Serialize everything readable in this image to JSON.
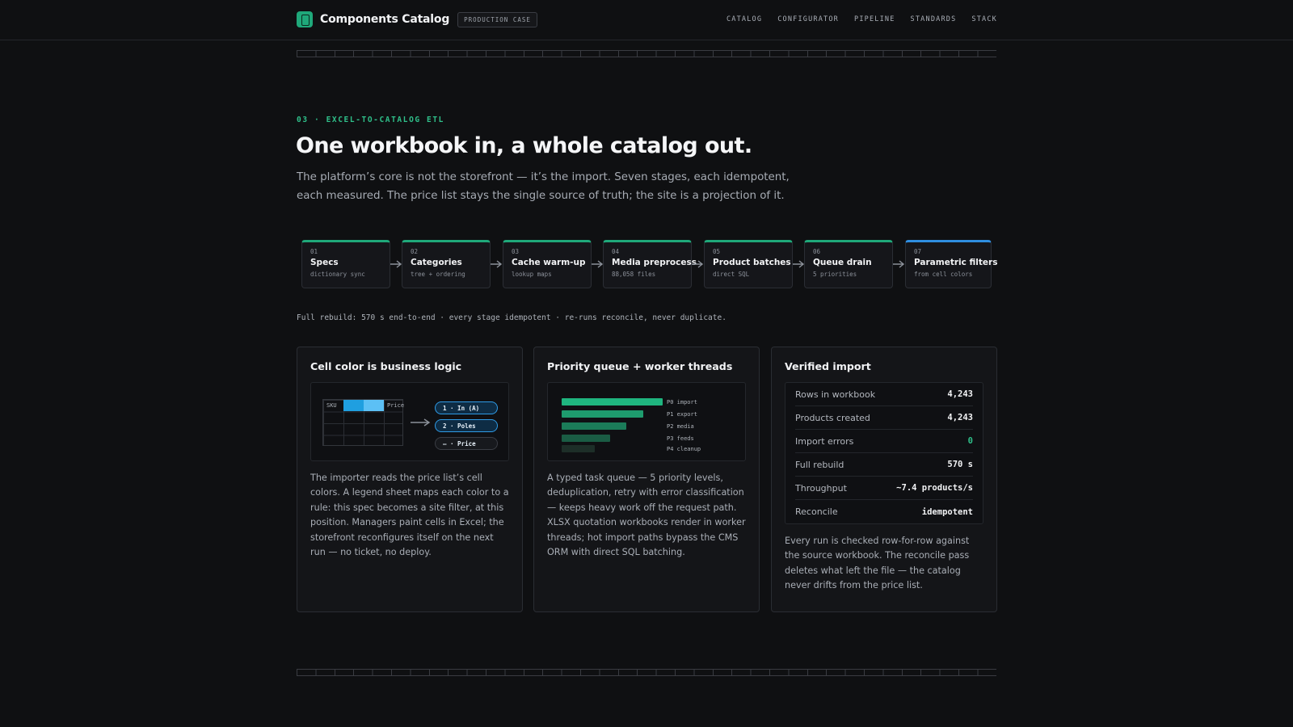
{
  "header": {
    "brand": "Components Catalog",
    "badge": "PRODUCTION CASE",
    "nav": [
      "CATALOG",
      "CONFIGURATOR",
      "PIPELINE",
      "STANDARDS",
      "STACK"
    ]
  },
  "hero": {
    "eyebrow": "03 · EXCEL-TO-CATALOG ETL",
    "title": "One workbook in, a whole catalog out.",
    "lede": "The platform’s core is not the storefront — it’s the import. Seven stages, each idempotent, each measured. The price list stays the single source of truth; the site is a projection of it."
  },
  "pipeline": [
    {
      "num": "01",
      "title": "Specs",
      "sub": "dictionary sync"
    },
    {
      "num": "02",
      "title": "Categories",
      "sub": "tree + ordering"
    },
    {
      "num": "03",
      "title": "Cache warm-up",
      "sub": "lookup maps"
    },
    {
      "num": "04",
      "title": "Media preprocess",
      "sub": "88,058 files"
    },
    {
      "num": "05",
      "title": "Product batches",
      "sub": "direct SQL"
    },
    {
      "num": "06",
      "title": "Queue drain",
      "sub": "5 priorities"
    },
    {
      "num": "07",
      "title": "Parametric filters",
      "sub": "from cell colors"
    }
  ],
  "rebuild_note": "Full rebuild: 570 s end-to-end · every stage idempotent · re-runs reconcile, never duplicate.",
  "cards": {
    "cell_color": {
      "title": "Cell color is business logic",
      "sheet_headers": {
        "sku": "SKU",
        "price": "Price"
      },
      "legend": [
        "1 · In (A)",
        "2 · Poles",
        "— · Price"
      ],
      "body": "The importer reads the price list’s cell colors. A legend sheet maps each color to a rule: this spec becomes a site filter, at this position. Managers paint cells in Excel; the storefront reconfigures itself on the next run — no ticket, no deploy."
    },
    "queue": {
      "title": "Priority queue + worker threads",
      "bars": [
        {
          "label": "P0 import",
          "level": 1.0
        },
        {
          "label": "P1 export",
          "level": 0.81
        },
        {
          "label": "P2 media",
          "level": 0.64
        },
        {
          "label": "P3 feeds",
          "level": 0.48
        },
        {
          "label": "P4 cleanup",
          "level": 0.33
        }
      ],
      "body": "A typed task queue — 5 priority levels, deduplication, retry with error classification — keeps heavy work off the request path. XLSX quotation workbooks render in worker threads; hot import paths bypass the CMS ORM with direct SQL batching."
    },
    "verified": {
      "title": "Verified import",
      "stats": [
        {
          "label": "Rows in workbook",
          "value": "4,243"
        },
        {
          "label": "Products created",
          "value": "4,243"
        },
        {
          "label": "Import errors",
          "value": "0"
        },
        {
          "label": "Full rebuild",
          "value": "570 s"
        },
        {
          "label": "Throughput",
          "value": "~7.4 products/s"
        },
        {
          "label": "Reconcile",
          "value": "idempotent"
        }
      ],
      "body": "Every run is checked row-for-row against the source workbook. The reconcile pass deletes what left the file — the catalog never drifts from the price list."
    }
  },
  "colors": {
    "accent_green": "#1fa87a",
    "accent_blue": "#2f8ee0",
    "background": "#0f1012"
  }
}
